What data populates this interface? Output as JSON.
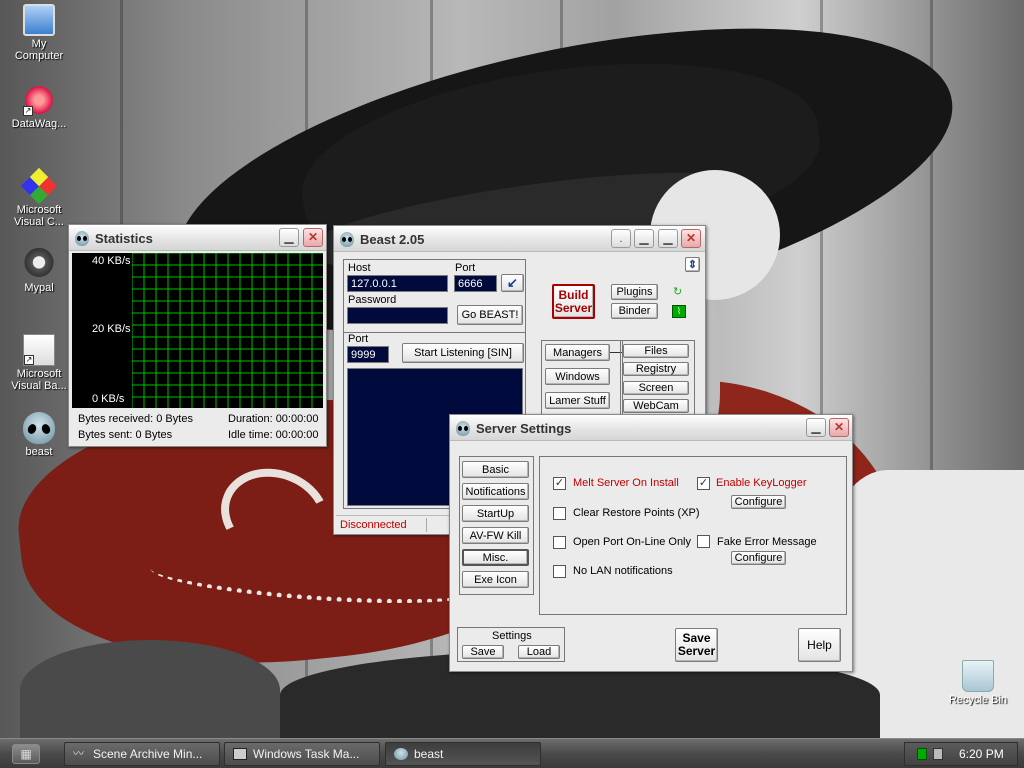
{
  "desktop": {
    "icons": [
      {
        "label": "My\nComputer"
      },
      {
        "label": "DataWag..."
      },
      {
        "label": "Microsoft\nVisual C..."
      },
      {
        "label": "Mypal"
      },
      {
        "label": "Microsoft\nVisual Ba..."
      },
      {
        "label": "beast"
      },
      {
        "label": "Recycle Bin"
      }
    ]
  },
  "statistics": {
    "title": "Statistics",
    "y_labels": [
      "40 KB/s",
      "20 KB/s",
      "0 KB/s"
    ],
    "bytes_received": "Bytes received: 0 Bytes",
    "bytes_sent": "Bytes sent: 0 Bytes",
    "duration": "Duration: 00:00:00",
    "idle_time": "Idle time: 00:00:00",
    "graph_color": "#00c000"
  },
  "beast": {
    "title": "Beast 2.05",
    "host_label": "Host",
    "host_value": "127.0.0.1",
    "port_label": "Port",
    "port_value": "6666",
    "password_label": "Password",
    "password_value": "",
    "go_button": "Go BEAST!",
    "listen_port_label": "Port",
    "listen_port_value": "9999",
    "listen_button": "Start Listening [SIN]",
    "build_server": "Build\nServer",
    "plugins": "Plugins",
    "binder": "Binder",
    "managers": "Managers",
    "windows": "Windows",
    "lamer_stuff": "Lamer Stuff",
    "files": "Files",
    "registry": "Registry",
    "screen": "Screen",
    "webcam": "WebCam",
    "status": "Disconnected",
    "status_color": "#c00000"
  },
  "server_settings": {
    "title": "Server Settings",
    "nav": [
      "Basic",
      "Notifications",
      "StartUp",
      "AV-FW Kill",
      "Misc.",
      "Exe Icon"
    ],
    "options": {
      "melt_server": "Melt Server On Install",
      "clear_restore": "Clear Restore Points (XP)",
      "open_port": "Open Port On-Line Only",
      "no_lan": "No LAN notifications",
      "enable_keylogger": "Enable KeyLogger",
      "fake_error": "Fake Error Message",
      "configure": "Configure"
    },
    "checked": {
      "melt_server": true,
      "clear_restore": false,
      "open_port": false,
      "no_lan": false,
      "enable_keylogger": true,
      "fake_error": false
    },
    "settings_label": "Settings",
    "save": "Save",
    "load": "Load",
    "save_server": "Save\nServer",
    "help": "Help"
  },
  "taskbar": {
    "tasks": [
      "Scene Archive Min...",
      "Windows Task Ma...",
      "beast"
    ],
    "clock": "6:20 PM"
  }
}
